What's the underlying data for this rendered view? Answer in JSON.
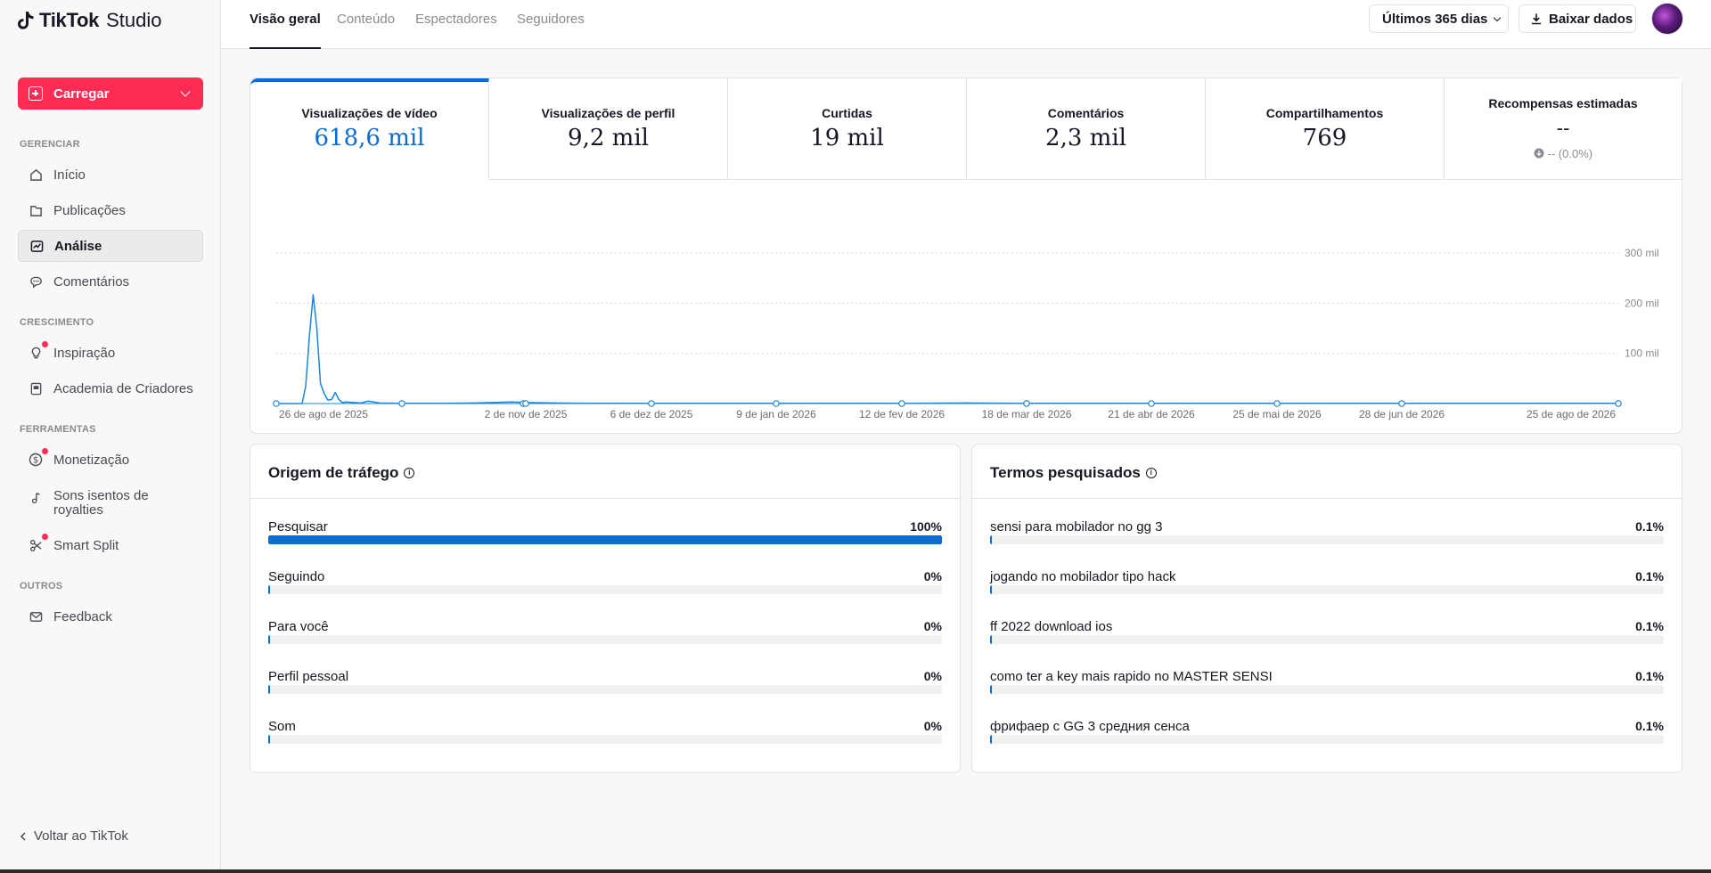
{
  "app": {
    "logo_brand": "TikTok",
    "logo_product": "Studio"
  },
  "sidebar": {
    "upload_label": "Carregar",
    "sections": [
      {
        "label": "GERENCIAR"
      },
      {
        "label": "CRESCIMENTO"
      },
      {
        "label": "FERRAMENTAS"
      },
      {
        "label": "OUTROS"
      }
    ],
    "items": [
      {
        "label": "Início",
        "icon": "home-icon"
      },
      {
        "label": "Publicações",
        "icon": "posts-icon"
      },
      {
        "label": "Análise",
        "icon": "analytics-icon",
        "active": true
      },
      {
        "label": "Comentários",
        "icon": "comments-icon"
      },
      {
        "label": "Inspiração",
        "icon": "lightbulb-icon",
        "badge": true
      },
      {
        "label": "Academia de Criadores",
        "icon": "academy-icon"
      },
      {
        "label": "Monetização",
        "icon": "dollar-icon",
        "badge": true
      },
      {
        "label": "Sons isentos de royalties",
        "icon": "music-note-icon"
      },
      {
        "label": "Smart Split",
        "icon": "scissors-icon",
        "badge": true
      },
      {
        "label": "Feedback",
        "icon": "mail-icon"
      }
    ],
    "back_label": "Voltar ao TikTok"
  },
  "header": {
    "tabs": [
      {
        "label": "Visão geral",
        "active": true
      },
      {
        "label": "Conteúdo"
      },
      {
        "label": "Espectadores"
      },
      {
        "label": "Seguidores"
      }
    ],
    "range_label": "Últimos 365 dias",
    "download_label": "Baixar dados"
  },
  "metrics": [
    {
      "label": "Visualizações de vídeo",
      "value": "618,6 mil",
      "active": true
    },
    {
      "label": "Visualizações de perfil",
      "value": "9,2 mil"
    },
    {
      "label": "Curtidas",
      "value": "19 mil"
    },
    {
      "label": "Comentários",
      "value": "2,3 mil"
    },
    {
      "label": "Compartilhamentos",
      "value": "769"
    },
    {
      "label": "Recompensas estimadas",
      "value": "--",
      "sub": "-- (0.0%)"
    }
  ],
  "chart_data": {
    "type": "line",
    "x_tick_labels": [
      "26 de ago de 2025",
      "2 de nov de 2025",
      "6 de dez de 2025",
      "9 de jan de 2026",
      "12 de fev de 2026",
      "18 de mar de 2026",
      "21 de abr de 2026",
      "25 de mai de 2026",
      "28 de jun de 2026",
      "25 de ago de 2026"
    ],
    "y_tick_labels": [
      "300 mil",
      "200 mil",
      "100 mil"
    ],
    "ylim": [
      0,
      300000
    ],
    "series": [
      {
        "color": "#1a86e0",
        "x": [
          "2025-08-26",
          "2025-09-02",
          "2025-09-03",
          "2025-09-04",
          "2025-09-05",
          "2025-09-06",
          "2025-09-07",
          "2025-09-08",
          "2025-09-09",
          "2025-09-10",
          "2025-09-11",
          "2025-09-12",
          "2025-09-13",
          "2025-09-14",
          "2025-09-16",
          "2025-09-18",
          "2025-09-20",
          "2025-09-23",
          "2025-09-29",
          "2025-10-09",
          "2025-10-19",
          "2025-10-29",
          "2025-11-02",
          "2025-11-10",
          "2025-11-20",
          "2025-12-06",
          "2025-12-20",
          "2026-01-09",
          "2026-02-12",
          "2026-03-01",
          "2026-03-18",
          "2026-04-21",
          "2026-05-25",
          "2026-06-28",
          "2026-08-25"
        ],
        "y": [
          0,
          0,
          35000,
          135000,
          217000,
          150000,
          40000,
          20000,
          7000,
          8000,
          22000,
          8000,
          2000,
          3000,
          2000,
          1000,
          5000,
          1000,
          500,
          500,
          1000,
          3000,
          2000,
          1000,
          500,
          500,
          500,
          500,
          500,
          1000,
          300,
          300,
          300,
          300,
          300
        ]
      }
    ]
  },
  "traffic": {
    "title": "Origem de tráfego",
    "rows": [
      {
        "label": "Pesquisar",
        "value": "100%",
        "pct": 100
      },
      {
        "label": "Seguindo",
        "value": "0%",
        "pct": 0
      },
      {
        "label": "Para você",
        "value": "0%",
        "pct": 0
      },
      {
        "label": "Perfil pessoal",
        "value": "0%",
        "pct": 0
      },
      {
        "label": "Som",
        "value": "0%",
        "pct": 0
      }
    ]
  },
  "terms": {
    "title": "Termos pesquisados",
    "rows": [
      {
        "label": "sensi para mobilador no gg 3",
        "value": "0.1%",
        "pct": 0.1
      },
      {
        "label": "jogando no mobilador tipo hack",
        "value": "0.1%",
        "pct": 0.1
      },
      {
        "label": "ff 2022 download ios",
        "value": "0.1%",
        "pct": 0.1
      },
      {
        "label": "como ter a key mais rapido no MASTER SENSI",
        "value": "0.1%",
        "pct": 0.1
      },
      {
        "label": "фрифаер с GG 3 средния сенса",
        "value": "0.1%",
        "pct": 0.1
      }
    ]
  }
}
